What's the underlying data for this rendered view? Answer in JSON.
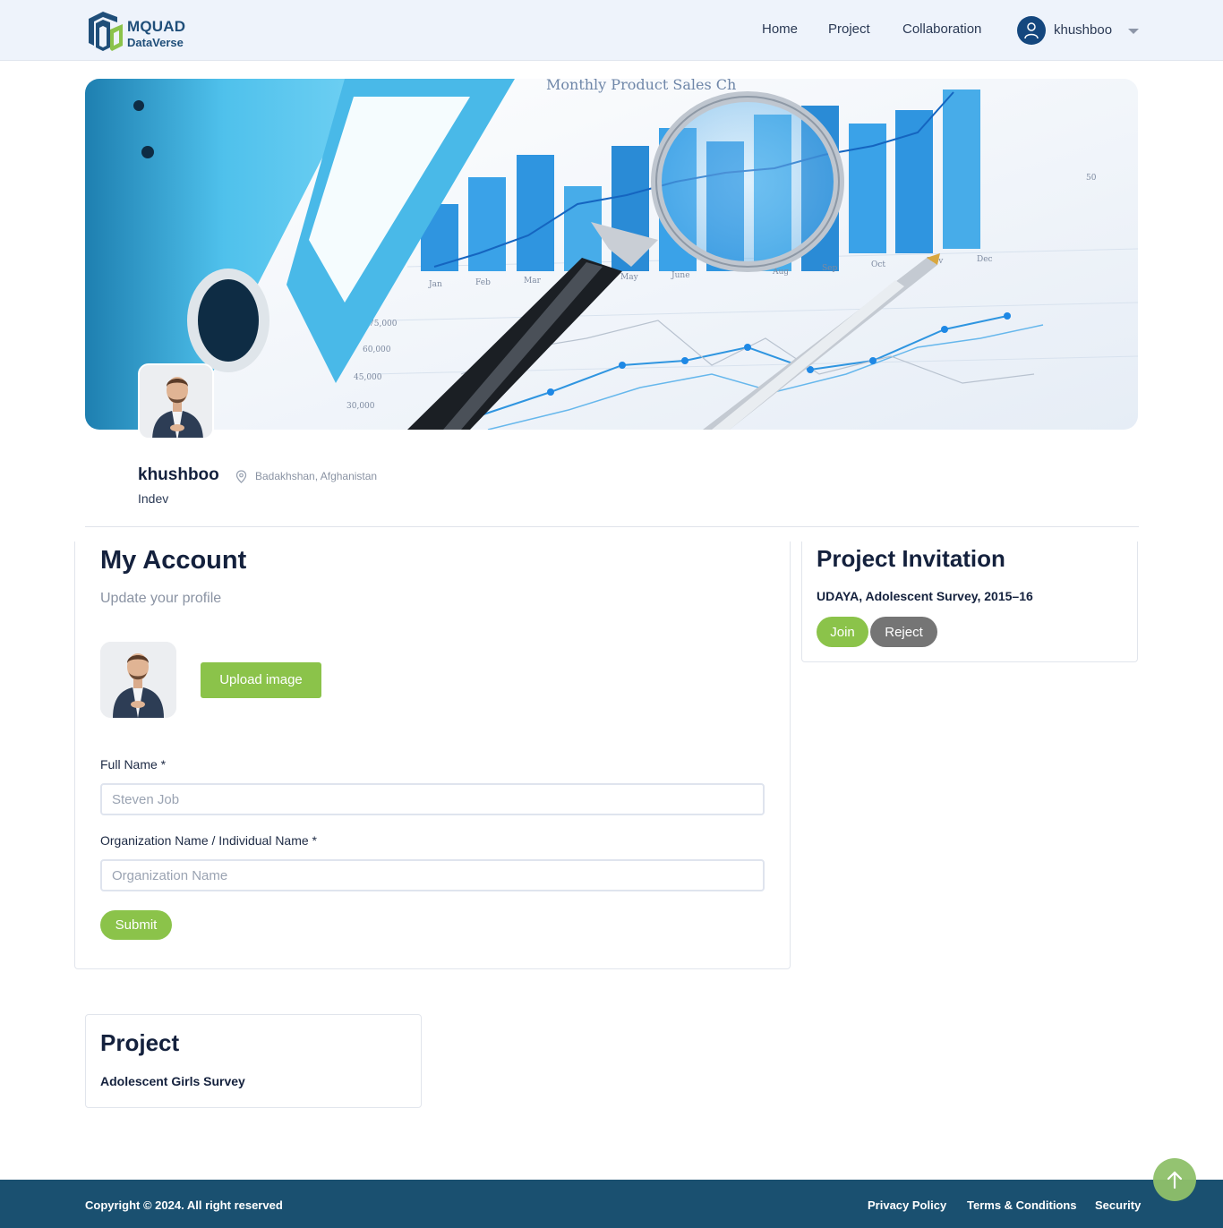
{
  "brand": {
    "name_line1": "MQUAD",
    "name_line2": "DataVerse"
  },
  "nav": {
    "home": "Home",
    "project": "Project",
    "collaboration": "Collaboration"
  },
  "user": {
    "name": "khushboo",
    "icon": "user-icon"
  },
  "banner": {
    "chart_title": "Monthly Product Sales Ch",
    "icon": "magnifying-glass-chart-photo"
  },
  "profile": {
    "name": "khushboo",
    "location": "Badakhshan, Afghanistan",
    "role": "Indev"
  },
  "account": {
    "title": "My Account",
    "subtitle": "Update your profile",
    "upload_label": "Upload image",
    "full_name_label": "Full Name *",
    "full_name_placeholder": "Steven Job",
    "org_label": "Organization Name / Individual Name *",
    "org_placeholder": "Organization Name",
    "submit_label": "Submit"
  },
  "invitation": {
    "title": "Project Invitation",
    "project": "UDAYA, Adolescent Survey, 2015–16",
    "join_label": "Join",
    "reject_label": "Reject"
  },
  "project": {
    "title": "Project",
    "item": "Adolescent Girls Survey"
  },
  "footer": {
    "copyright": "Copyright © 2024. All right reserved",
    "privacy": "Privacy Policy",
    "terms": "Terms & Conditions",
    "security": "Security"
  },
  "colors": {
    "accent": "#8bc34a",
    "navy": "#14477e",
    "footer": "#1a5070",
    "reject": "#757575"
  }
}
